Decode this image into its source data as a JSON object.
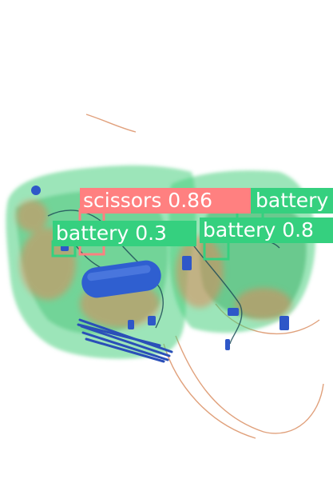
{
  "image": {
    "description_free_note": "",
    "background": "#ffffff"
  },
  "detections": [
    {
      "label": "scissors 0.86",
      "class": "scissors",
      "score": "0.86",
      "color": "#ff8080"
    },
    {
      "label": "battery",
      "class": "battery",
      "score": "",
      "color": "#35d07f"
    },
    {
      "label": "battery 0.3",
      "class": "battery",
      "score": "0.3",
      "color": "#35d07f"
    },
    {
      "label": "battery 0.8",
      "class": "battery",
      "score": "0.8",
      "color": "#35d07f"
    }
  ],
  "colors": {
    "scissors": "#ff8080",
    "battery": "#35d07f",
    "xray_green": "#3fcf6a",
    "xray_orange": "#e0895a",
    "xray_blue": "#2f5fd0"
  }
}
